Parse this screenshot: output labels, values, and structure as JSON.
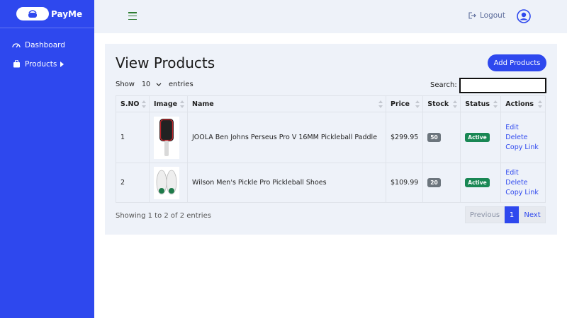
{
  "app": {
    "name": "PayMe"
  },
  "sidebar": {
    "items": [
      {
        "label": "Dashboard",
        "icon": "dashboard-icon"
      },
      {
        "label": "Products",
        "icon": "shopping-bag-icon"
      }
    ]
  },
  "topbar": {
    "logout_label": "Logout"
  },
  "page": {
    "title": "View Products",
    "add_button": "Add Products",
    "show_label": "Show",
    "entries_label": "entries",
    "page_size": "10",
    "search_label": "Search:",
    "search_value": ""
  },
  "table": {
    "headers": [
      "S.NO",
      "Image",
      "Name",
      "Price",
      "Stock",
      "Status",
      "Actions"
    ],
    "rows": [
      {
        "sno": "1",
        "name": "JOOLA Ben Johns Perseus Pro V 16MM Pickleball Paddle",
        "price": "$299.95",
        "stock": "50",
        "status": "Active",
        "image": "pickleball-paddle-image"
      },
      {
        "sno": "2",
        "name": "Wilson Men's Pickle Pro Pickleball Shoes",
        "price": "$109.99",
        "stock": "20",
        "status": "Active",
        "image": "pickleball-shoes-image"
      }
    ],
    "actions": [
      "Edit",
      "Delete",
      "Copy Link"
    ]
  },
  "footer": {
    "info": "Showing 1 to 2 of 2 entries",
    "prev_label": "Previous",
    "current_page": "1",
    "next_label": "Next"
  },
  "colors": {
    "primary": "#2e48ee",
    "active": "#198754",
    "stock": "#6c757d",
    "panel": "#eef2f9"
  }
}
